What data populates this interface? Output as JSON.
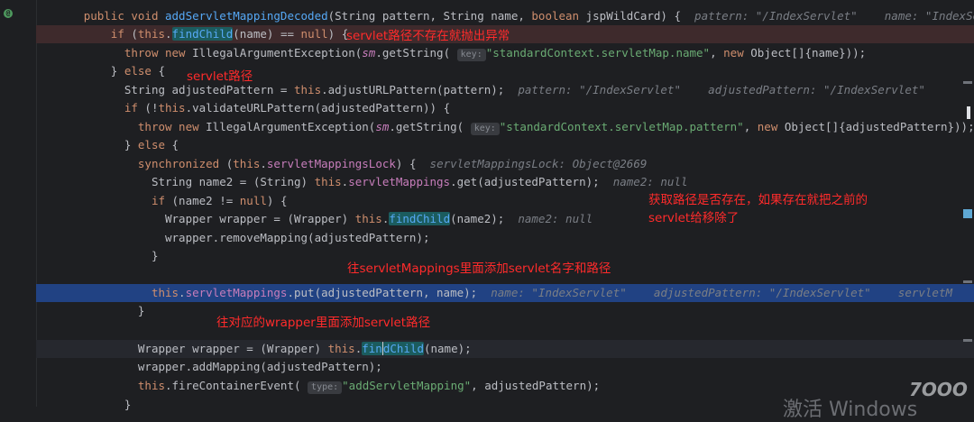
{
  "editor": {
    "lines": [
      {
        "indent": "  ",
        "parts": [
          {
            "t": "public void ",
            "c": "kw"
          },
          {
            "t": "addServletMappingDecoded",
            "c": "fn"
          },
          {
            "t": "(String pattern, String name, "
          },
          {
            "t": "boolean ",
            "c": "kw"
          },
          {
            "t": "jspWildCard) {  "
          },
          {
            "t": "pattern: \"/IndexServlet\"    name: \"IndexServ",
            "c": "hint"
          }
        ]
      },
      {
        "indent": "      ",
        "hl": "red",
        "parts": [
          {
            "t": "if ",
            "c": "kw"
          },
          {
            "t": "("
          },
          {
            "t": "this",
            "c": "kw"
          },
          {
            "t": "."
          },
          {
            "t": "findChild",
            "c": "fn",
            "m": true
          },
          {
            "t": "(name) == "
          },
          {
            "t": "null",
            "c": "kw"
          },
          {
            "t": ") {"
          }
        ]
      },
      {
        "indent": "        ",
        "parts": [
          {
            "t": "throw new ",
            "c": "kw"
          },
          {
            "t": "IllegalArgumentException("
          },
          {
            "t": "sm",
            "c": "it"
          },
          {
            "t": ".getString( "
          },
          {
            "b": "key:"
          },
          {
            "t": "\"standardContext.servletMap.name\"",
            "c": "str"
          },
          {
            "t": ", "
          },
          {
            "t": "new ",
            "c": "kw"
          },
          {
            "t": "Object[]{name}));"
          }
        ]
      },
      {
        "indent": "      ",
        "parts": [
          {
            "t": "} "
          },
          {
            "t": "else ",
            "c": "kw"
          },
          {
            "t": "{"
          }
        ]
      },
      {
        "indent": "        ",
        "parts": [
          {
            "t": "String adjustedPattern = "
          },
          {
            "t": "this",
            "c": "kw"
          },
          {
            "t": ".adjustURLPattern(pattern);  "
          },
          {
            "t": "pattern: \"/IndexServlet\"    adjustedPattern: \"/IndexServlet\"",
            "c": "hint"
          }
        ]
      },
      {
        "indent": "        ",
        "parts": [
          {
            "t": "if ",
            "c": "kw"
          },
          {
            "t": "(!"
          },
          {
            "t": "this",
            "c": "kw"
          },
          {
            "t": ".validateURLPattern(adjustedPattern)) {"
          }
        ]
      },
      {
        "indent": "          ",
        "parts": [
          {
            "t": "throw new ",
            "c": "kw"
          },
          {
            "t": "IllegalArgumentException("
          },
          {
            "t": "sm",
            "c": "it"
          },
          {
            "t": ".getString( "
          },
          {
            "b": "key:"
          },
          {
            "t": "\"standardContext.servletMap.pattern\"",
            "c": "str"
          },
          {
            "t": ", "
          },
          {
            "t": "new ",
            "c": "kw"
          },
          {
            "t": "Object[]{adjustedPattern}));"
          }
        ]
      },
      {
        "indent": "        ",
        "parts": [
          {
            "t": "} "
          },
          {
            "t": "else ",
            "c": "kw"
          },
          {
            "t": "{"
          }
        ]
      },
      {
        "indent": "          ",
        "parts": [
          {
            "t": "synchronized ",
            "c": "kw"
          },
          {
            "t": "("
          },
          {
            "t": "this",
            "c": "kw"
          },
          {
            "t": "."
          },
          {
            "t": "servletMappingsLock",
            "c": "fld"
          },
          {
            "t": ") {  "
          },
          {
            "t": "servletMappingsLock: Object@2669",
            "c": "hint"
          }
        ]
      },
      {
        "indent": "            ",
        "parts": [
          {
            "t": "String name2 = (String) "
          },
          {
            "t": "this",
            "c": "kw"
          },
          {
            "t": "."
          },
          {
            "t": "servletMappings",
            "c": "fld"
          },
          {
            "t": ".get(adjustedPattern);  "
          },
          {
            "t": "name2: null",
            "c": "hint"
          }
        ]
      },
      {
        "indent": "            ",
        "parts": [
          {
            "t": "if ",
            "c": "kw"
          },
          {
            "t": "(name2 != "
          },
          {
            "t": "null",
            "c": "kw"
          },
          {
            "t": ") {"
          }
        ]
      },
      {
        "indent": "              ",
        "parts": [
          {
            "t": "Wrapper wrapper = (Wrapper) "
          },
          {
            "t": "this",
            "c": "kw"
          },
          {
            "t": "."
          },
          {
            "t": "findChild",
            "c": "fn",
            "m": true
          },
          {
            "t": "(name2);  "
          },
          {
            "t": "name2: null",
            "c": "hint"
          }
        ]
      },
      {
        "indent": "              ",
        "parts": [
          {
            "t": "wrapper.removeMapping(adjustedPattern);"
          }
        ]
      },
      {
        "indent": "            ",
        "parts": [
          {
            "t": "}"
          }
        ]
      },
      {
        "indent": "",
        "parts": []
      },
      {
        "indent": "            ",
        "hl": "blue",
        "parts": [
          {
            "t": "this",
            "c": "kw"
          },
          {
            "t": "."
          },
          {
            "t": "servletMappings",
            "c": "fld"
          },
          {
            "t": ".put(adjustedPattern, name);  "
          },
          {
            "t": "name: \"IndexServlet\"    adjustedPattern: \"/IndexServlet\"    servletM",
            "c": "hint"
          }
        ]
      },
      {
        "indent": "          ",
        "parts": [
          {
            "t": "}"
          }
        ]
      },
      {
        "indent": "",
        "parts": []
      },
      {
        "indent": "          ",
        "hl": "cur",
        "parts": [
          {
            "t": "Wrapper wrapper = (Wrapper) "
          },
          {
            "t": "this",
            "c": "kw"
          },
          {
            "t": "."
          },
          {
            "t": "fin",
            "c": "fn",
            "m": true
          },
          {
            "cur": true
          },
          {
            "t": "dChild",
            "c": "fn",
            "m": true
          },
          {
            "t": "(name);"
          }
        ]
      },
      {
        "indent": "          ",
        "parts": [
          {
            "t": "wrapper.addMapping(adjustedPattern);"
          }
        ]
      },
      {
        "indent": "          ",
        "parts": [
          {
            "t": "this",
            "c": "kw"
          },
          {
            "t": ".fireContainerEvent( "
          },
          {
            "b": "type:"
          },
          {
            "t": "\"addServletMapping\"",
            "c": "str"
          },
          {
            "t": ", adjustedPattern);"
          }
        ]
      },
      {
        "indent": "        ",
        "parts": [
          {
            "t": "}"
          }
        ]
      }
    ]
  },
  "annotations": {
    "throw_note": "servlet路径不存在就抛出异常",
    "path_note": "servlet路径",
    "remove_note_1": "获取路径是否存在，如果存在就把之前的",
    "remove_note_2": "servlet给移除了",
    "put_note": "往servletMappings里面添加servlet名字和路径",
    "wrapper_note": "往对应的wrapper里面添加servlet路径"
  },
  "overlay": {
    "watermark": "激活 Windows",
    "logo": "7OOO"
  }
}
